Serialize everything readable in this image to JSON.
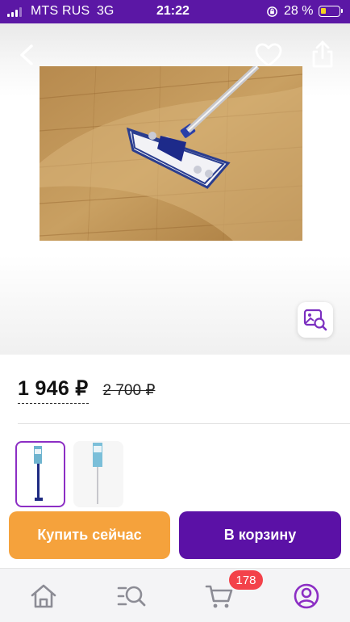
{
  "status_bar": {
    "carrier": "MTS RUS",
    "network": "3G",
    "time": "21:22",
    "battery_percent": "28 %",
    "battery_level": 0.28
  },
  "gallery": {
    "back_icon": "chevron-left-icon",
    "favorite_icon": "heart-icon",
    "share_icon": "share-icon",
    "image_search_icon": "image-search-icon"
  },
  "price": {
    "current": "1 946 ₽",
    "old": "2 700 ₽"
  },
  "thumbnails": [
    {
      "selected": true
    },
    {
      "selected": false
    }
  ],
  "actions": {
    "buy_now": "Купить сейчас",
    "add_to_cart": "В корзину"
  },
  "tab_bar": {
    "items": [
      {
        "icon": "home-icon"
      },
      {
        "icon": "catalog-search-icon"
      },
      {
        "icon": "cart-icon"
      },
      {
        "icon": "profile-icon",
        "active": true
      }
    ],
    "cart_badge": "178"
  },
  "colors": {
    "brand_purple": "#5b11a6",
    "buy_orange": "#f5a23c",
    "badge_red": "#f3424a",
    "accent_purple": "#8c2ec4"
  }
}
